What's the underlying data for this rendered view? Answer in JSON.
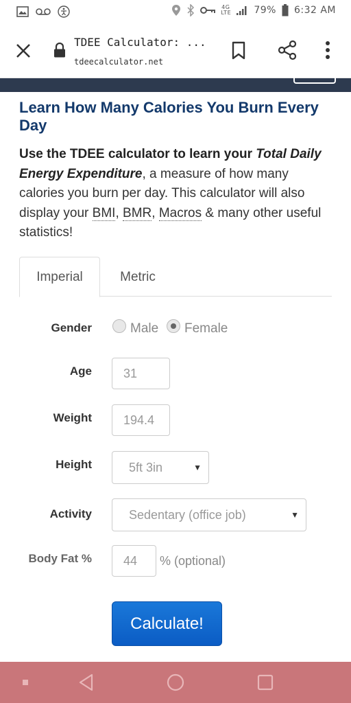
{
  "status_bar": {
    "battery": "79%",
    "time": "6:32 AM",
    "network": "4G LTE"
  },
  "browser": {
    "title": "TDEE Calculator: ...",
    "url": "tdeecalculator.net"
  },
  "page": {
    "headline": "Learn How Many Calories You Burn Every Day",
    "intro_lead": "Use the TDEE calculator to learn your ",
    "intro_em": "Total Daily Energy Expenditure",
    "intro_rest_1": ", a measure of how many calories you burn per day. This calculator will also display your ",
    "intro_bmi": "BMI",
    "intro_comma": ", ",
    "intro_bmr": "BMR",
    "intro_comma2": ", ",
    "intro_macros": "Macros",
    "intro_rest_2": " & many other useful statistics!"
  },
  "tabs": {
    "imperial": "Imperial",
    "metric": "Metric"
  },
  "form": {
    "gender_label": "Gender",
    "male_label": "Male",
    "female_label": "Female",
    "age_label": "Age",
    "age_value": "31",
    "weight_label": "Weight",
    "weight_value": "194.4",
    "height_label": "Height",
    "height_value": "5ft 3in",
    "activity_label": "Activity",
    "activity_value": "Sedentary (office job)",
    "bodyfat_label": "Body Fat %",
    "bodyfat_value": "44",
    "bodyfat_hint": "% (optional)",
    "calculate_label": "Calculate!"
  },
  "colors": {
    "headline": "#13396b",
    "site_header": "#2d3a4f",
    "button": "#0b5cc4",
    "nav_bar": "#c9767a"
  }
}
